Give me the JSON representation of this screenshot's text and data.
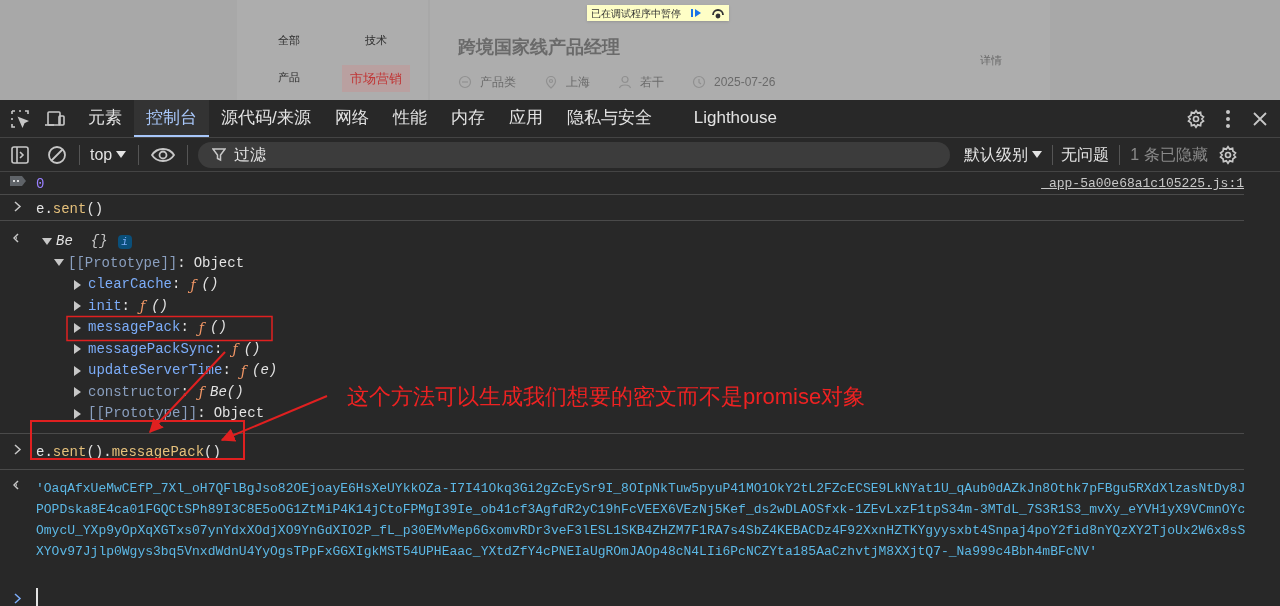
{
  "page": {
    "debugger_banner": "已在调试程序中暂停",
    "categories": [
      {
        "label": "全部",
        "selected": false
      },
      {
        "label": "技术",
        "selected": false
      },
      {
        "label": "产品",
        "selected": false
      },
      {
        "label": "市场营销",
        "selected": true
      }
    ],
    "job": {
      "title": "跨境国家线产品经理",
      "meta": [
        {
          "kind": "category",
          "text": "产品类"
        },
        {
          "kind": "location",
          "text": "上海"
        },
        {
          "kind": "headcount",
          "text": "若干"
        },
        {
          "kind": "date",
          "text": "2025-07-26"
        }
      ],
      "detail_link": "详情"
    }
  },
  "devtools": {
    "tabs": [
      {
        "label": "元素",
        "selected": false
      },
      {
        "label": "控制台",
        "selected": true
      },
      {
        "label": "源代码/来源",
        "selected": false
      },
      {
        "label": "网络",
        "selected": false
      },
      {
        "label": "性能",
        "selected": false
      },
      {
        "label": "内存",
        "selected": false
      },
      {
        "label": "应用",
        "selected": false
      },
      {
        "label": "隐私与安全",
        "selected": false
      },
      {
        "label": "Lighthouse",
        "selected": false
      }
    ],
    "toolbar": {
      "context": "top",
      "filter_placeholder": "过滤",
      "levels": "默认级别",
      "issues": "无问题",
      "hidden": "1 条已隐藏"
    },
    "console": [
      {
        "kind": "log",
        "text": "0",
        "source": "_app-5a00e68a1c105225.js:1"
      },
      {
        "kind": "input",
        "tokens": [
          {
            "kind": "plain",
            "text": "e."
          },
          {
            "kind": "call",
            "text": "sent"
          },
          {
            "kind": "plain",
            "text": "()"
          }
        ]
      },
      {
        "kind": "object",
        "tree": {
          "key": "Be",
          "value": "{}",
          "badge": "i",
          "expanded": true,
          "children": [
            {
              "key": "[[Prototype]]",
              "sep": ":",
              "value": "Object",
              "dim": true,
              "expanded": true,
              "children": [
                {
                  "key": "clearCache",
                  "sep": ":",
                  "sign": "ƒ",
                  "args": "()",
                  "dim": false,
                  "expanded": false
                },
                {
                  "key": "init",
                  "sep": ":",
                  "sign": "ƒ",
                  "args": "()",
                  "dim": false,
                  "expanded": false
                },
                {
                  "key": "messagePack",
                  "sep": ":",
                  "sign": "ƒ",
                  "args": "()",
                  "dim": false,
                  "expanded": false
                },
                {
                  "key": "messagePackSync",
                  "sep": ":",
                  "sign": "ƒ",
                  "args": "()",
                  "dim": false,
                  "expanded": false
                },
                {
                  "key": "updateServerTime",
                  "sep": ":",
                  "sign": "ƒ",
                  "args": "(e)",
                  "dim": false,
                  "expanded": false
                },
                {
                  "key": "constructor",
                  "sep": ":",
                  "sign": "ƒ",
                  "args": "Be()",
                  "dim": true,
                  "expanded": false
                },
                {
                  "key": "[[Prototype]]",
                  "sep": ":",
                  "value": "Object",
                  "dim": true,
                  "expanded": false
                }
              ]
            }
          ]
        }
      },
      {
        "kind": "input",
        "tokens": [
          {
            "kind": "plain",
            "text": "e."
          },
          {
            "kind": "call",
            "text": "sent"
          },
          {
            "kind": "plain",
            "text": "()."
          },
          {
            "kind": "call",
            "text": "messagePack"
          },
          {
            "kind": "plain",
            "text": "()"
          }
        ]
      },
      {
        "kind": "string",
        "text": "'OaqAfxUeMwCEfP_7Xl_oH7QFlBgJso82OEjoayE6HsXeUYkkOZa-I7I41Okq3Gi2gZcEySr9I_8OIpNkTuw5pyuP41MO1OkY2tL2FZcECSE9LkNYat1U_qAub0dAZkJn8Othk7pFBgu5RXdXlzasNtDy8JPOPDska8E4ca01FGQCtSPh89I3C8E5oOG1ZtMiP4K14jCtoFPMgI39Ie_ob41cf3AgfdR2yC19hFcVEEX6VEzNj5Kef_ds2wDLAOSfxk-1ZEvLxzF1tpS34m-3MTdL_7S3R1S3_mvXy_eYVH1yX9VCmnOYcOmycU_YXp9yOpXqXGTxs07ynYdxXOdjXO9YnGdXIO2P_fL_p30EMvMep6GxomvRDr3veF3lESL1SKB4ZHZM7F1RA7s4SbZ4KEBACDz4F92XxnHZTKYgyysxbt4Snpaj4poY2fid8nYQzXY2TjoUx2W6x8sSXYOv97Jjlp0Wgys3bq5VnxdWdnU4YyOgsTPpFxGGXIgkMST54UPHEaac_YXtdZfY4cPNEIaUgROmJAOp48cN4LIi6PcNCZYta185AaCzhvtjM8XXjtQ7-_Na999c4Bbh4mBFcNV'"
      },
      {
        "kind": "prompt"
      }
    ]
  },
  "annotation": {
    "text": "这个方法可以生成我们想要的密文而不是promise对象"
  }
}
